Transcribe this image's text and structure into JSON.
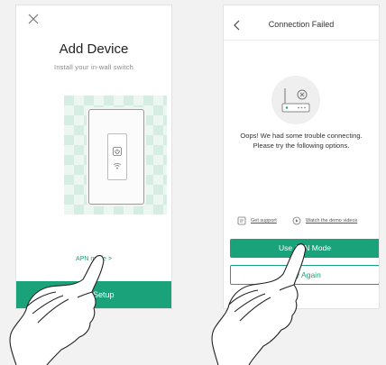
{
  "left_screen": {
    "title": "Add Device",
    "subtitle": "Install your in-wall switch",
    "apn_link": "APN mode >",
    "start_button": "Start Setup"
  },
  "right_screen": {
    "title": "Connection Failed",
    "message_line1": "Oops! We had some trouble connecting.",
    "message_line2": "Please try the following options.",
    "get_support": "Get support",
    "watch_videos": "Watch the demo videos",
    "use_apn_button": "Use APN Mode",
    "try_again_button": "Try Again"
  },
  "icons": {
    "close": "close-icon",
    "back": "chevron-left-icon",
    "power": "power-icon",
    "wifi": "wifi-icon",
    "router": "router-error-icon",
    "support": "document-icon",
    "play": "play-circle-icon",
    "hand": "pointing-hand-icon"
  },
  "colors": {
    "accent": "#1aa37a",
    "illustration_bg": "#d5ede3",
    "background": "#f2f2f2"
  }
}
